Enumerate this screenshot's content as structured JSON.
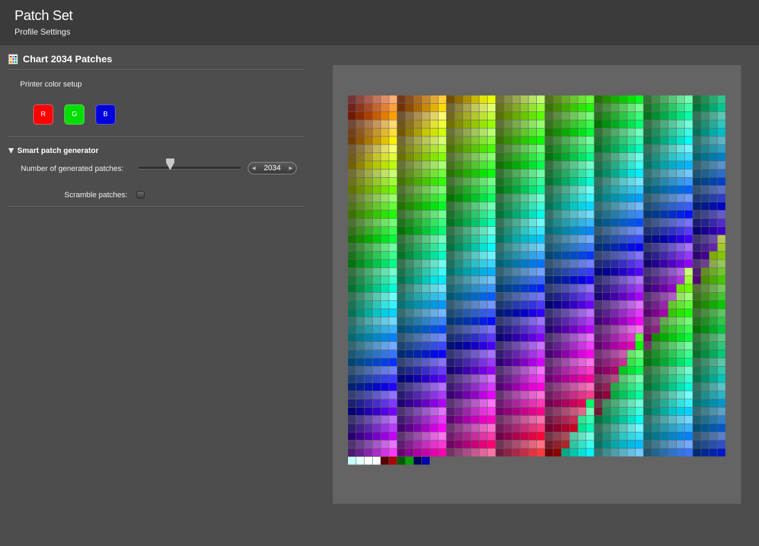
{
  "titlebar": {
    "title": "Patch Set",
    "subtitle": "Profile Settings"
  },
  "chart_section": {
    "icon": "color-chart-icon",
    "title": "Chart 2034 Patches"
  },
  "printer_setup": {
    "label": "Printer color setup",
    "buttons": [
      {
        "label": "R",
        "color": "#ff0000"
      },
      {
        "label": "G",
        "color": "#00dd00"
      },
      {
        "label": "B",
        "color": "#0000dd"
      }
    ]
  },
  "generator": {
    "title": "Smart patch generator",
    "patches_label": "Number of generated patches:",
    "patches_value": "2034",
    "scramble_label": "Scramble patches:",
    "scramble_checked": false
  },
  "preview": {
    "background": "#646464",
    "columns": 46,
    "rows": 45,
    "filled_cells_last_row": 10
  }
}
